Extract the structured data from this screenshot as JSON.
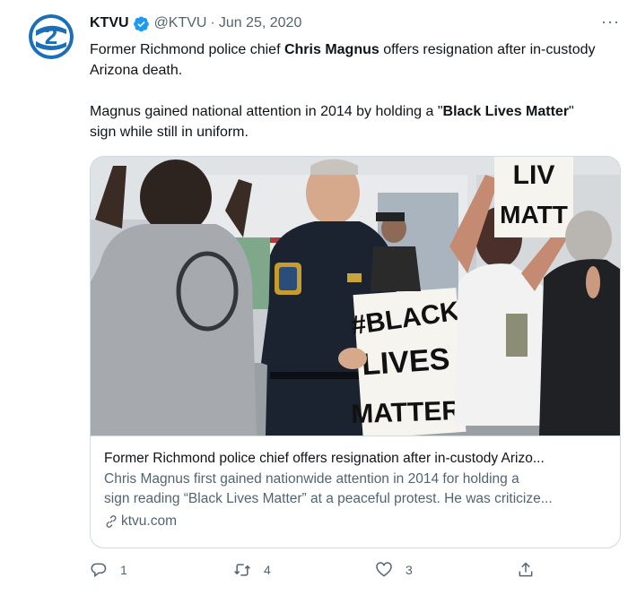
{
  "account": {
    "name": "KTVU",
    "handle": "@KTVU",
    "separator": "·",
    "date": "Jun 25, 2020",
    "brand_color": "#1a6fb8"
  },
  "menu": {
    "more_label": "···"
  },
  "tweet": {
    "p1_pre": "Former Richmond police chief ",
    "p1_bold": "Chris Magnus",
    "p1_post": " offers resignation after in-custody Arizona death.",
    "p2_pre": "Magnus gained national attention in 2014 by holding a \"",
    "p2_bold": "Black Lives Matter",
    "p2_post": "\" sign while still in uniform."
  },
  "card": {
    "image_sign_text": "#BLACK LIVES MATTER",
    "image_sign2_text": "LIV MATT",
    "title": "Former Richmond police chief offers resignation after in-custody Arizo...",
    "desc_line1": "Chris Magnus first gained nationwide attention in 2014 for holding a",
    "desc_line2": "sign reading “Black Lives Matter” at a peaceful protest. He was criticize...",
    "domain": "ktvu.com"
  },
  "actions": {
    "reply_count": "1",
    "retweet_count": "4",
    "like_count": "3"
  },
  "colors": {
    "text": "#0f1419",
    "secondary": "#536471",
    "border": "#cfd9de",
    "verified": "#1d9bf0"
  },
  "icons": [
    "ktvu-logo-icon",
    "verified-badge-icon",
    "more-icon",
    "link-icon",
    "reply-icon",
    "retweet-icon",
    "like-icon",
    "share-icon"
  ]
}
